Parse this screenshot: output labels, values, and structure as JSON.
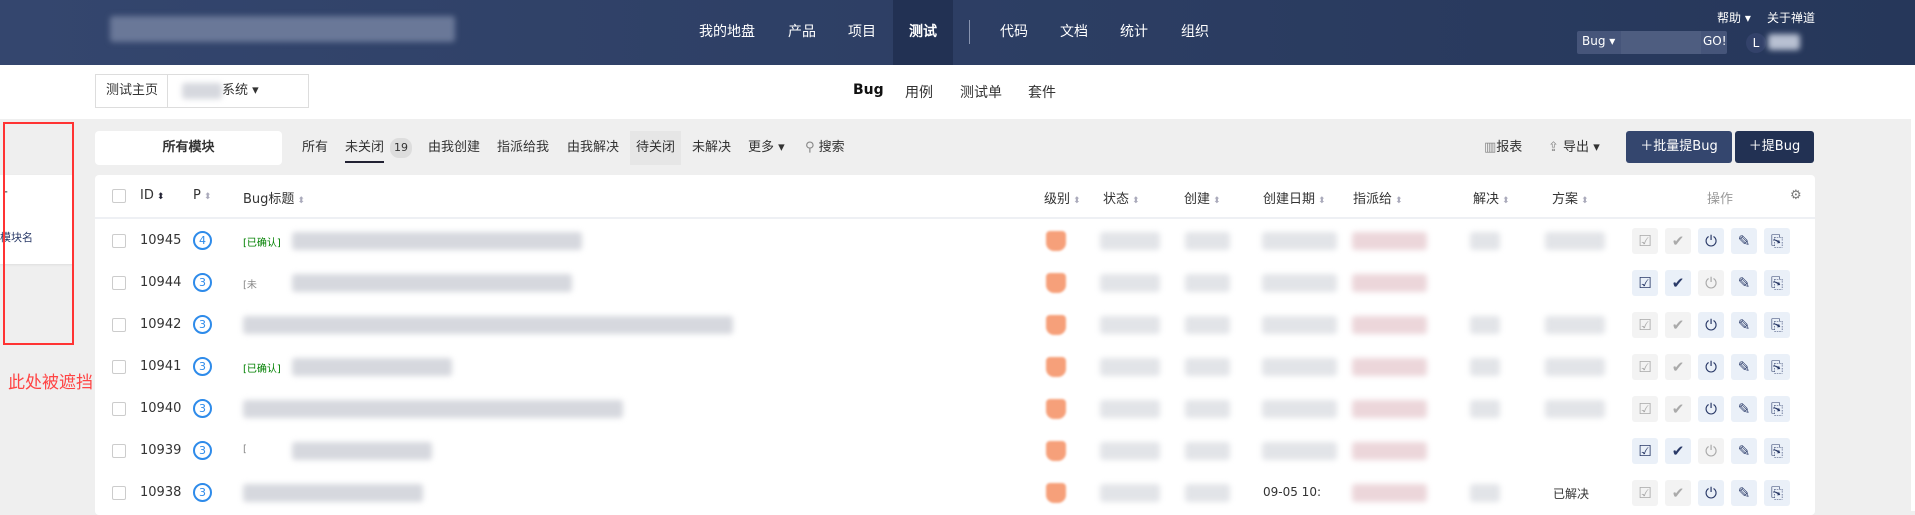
{
  "header": {
    "nav": [
      "我的地盘",
      "产品",
      "项目",
      "测试",
      "代码",
      "文档",
      "统计",
      "组织"
    ],
    "active": "测试",
    "help": "帮助",
    "about": "关于禅道",
    "search_type": "Bug",
    "search_go": "GO!",
    "avatar_initial": "L"
  },
  "breadcrumb": {
    "home": "测试主页",
    "product_suffix": "系统"
  },
  "subnav": {
    "items": [
      "Bug",
      "用例",
      "测试单",
      "套件"
    ],
    "active": "Bug"
  },
  "sidebar": {
    "module_name": "模块名",
    "obscured_note": "此处被遮挡"
  },
  "filters": {
    "module": "所有模块",
    "items": [
      "所有",
      "未关闭",
      "由我创建",
      "指派给我",
      "由我解决",
      "待关闭",
      "未解决",
      "更多"
    ],
    "unclosed_count": "19",
    "search": "搜索"
  },
  "toolbar": {
    "report": "报表",
    "export": "导出",
    "batch_create": "批量提Bug",
    "create": "提Bug"
  },
  "table": {
    "columns": [
      "ID",
      "P",
      "Bug标题",
      "级别",
      "状态",
      "创建",
      "创建日期",
      "指派给",
      "解决",
      "方案",
      "操作"
    ],
    "rows": [
      {
        "id": "10945",
        "p": "4",
        "tag": "[已确认]",
        "tag_color": "#008000",
        "date": "",
        "resolution": "",
        "actions_enabled": [
          false,
          false,
          true,
          true,
          true
        ]
      },
      {
        "id": "10944",
        "p": "3",
        "tag": "[未",
        "tag_color": "#888888",
        "date": "",
        "resolution": "",
        "actions_enabled": [
          true,
          true,
          false,
          true,
          true
        ]
      },
      {
        "id": "10942",
        "p": "3",
        "tag": "",
        "tag_color": "#888888",
        "date": "",
        "resolution": "",
        "actions_enabled": [
          false,
          false,
          true,
          true,
          true
        ]
      },
      {
        "id": "10941",
        "p": "3",
        "tag": "[已确认]",
        "tag_color": "#008000",
        "date": "",
        "resolution": "",
        "actions_enabled": [
          false,
          false,
          true,
          true,
          true
        ]
      },
      {
        "id": "10940",
        "p": "3",
        "tag": "",
        "tag_color": "#888888",
        "date": "",
        "resolution": "",
        "actions_enabled": [
          false,
          false,
          true,
          true,
          true
        ]
      },
      {
        "id": "10939",
        "p": "3",
        "tag": "[",
        "tag_color": "#888888",
        "date": "",
        "resolution": "",
        "actions_enabled": [
          true,
          true,
          false,
          true,
          true
        ]
      },
      {
        "id": "10938",
        "p": "3",
        "tag": "",
        "tag_color": "#888888",
        "date": "09-05 10:",
        "resolution": "已解决",
        "actions_enabled": [
          false,
          false,
          true,
          true,
          true
        ]
      }
    ]
  }
}
